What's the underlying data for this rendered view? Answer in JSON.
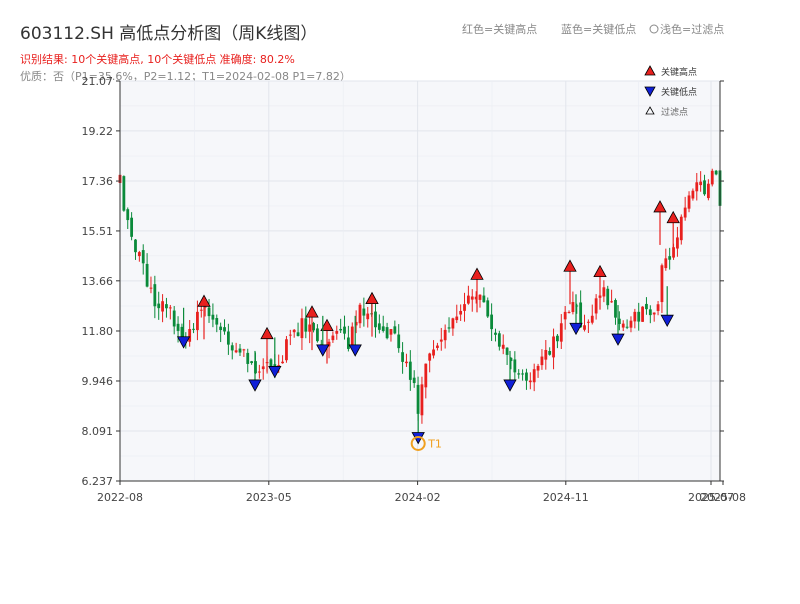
{
  "chart_data": {
    "type": "candlestick",
    "title": "603112.SH 高低点分析图（周K线图）",
    "subtitle_result": "识别结果: 10个关键高点, 10个关键低点   准确度: 80.2%",
    "subtitle_quality": "优质：否（P1=35.6%，P2=1.12；T1=2024-02-08 P1=7.82）",
    "header_legend": [
      "红色=关键高点",
      "蓝色=关键低点",
      "浅色=过滤点"
    ],
    "legend": [
      {
        "name": "关键高点",
        "marker": "triangle-up",
        "color": "#e8201e"
      },
      {
        "name": "关键低点",
        "marker": "triangle-down",
        "color": "#1020d8"
      },
      {
        "name": "过滤点",
        "marker": "triangle-up-hollow",
        "color": "#333333"
      }
    ],
    "y_ticks": [
      "6.237",
      "8.091",
      "9.946",
      "11.80",
      "13.66",
      "15.51",
      "17.36",
      "19.22",
      "21.07"
    ],
    "ylim": [
      6.237,
      21.07
    ],
    "x_ticks": [
      {
        "label": "2022-08",
        "t": 0.0
      },
      {
        "label": "2023-05",
        "t": 0.248
      },
      {
        "label": "2024-02",
        "t": 0.496
      },
      {
        "label": "2024-11",
        "t": 0.743
      },
      {
        "label": "2025-07",
        "t": 0.985
      },
      {
        "label": "2025-08",
        "t": 1.005
      }
    ],
    "grid_minor_t": [
      0.124,
      0.372,
      0.62,
      0.864
    ],
    "close_anchors": [
      [
        0.0,
        17.3
      ],
      [
        0.01,
        15.8
      ],
      [
        0.02,
        15.0
      ],
      [
        0.035,
        14.3
      ],
      [
        0.05,
        13.5
      ],
      [
        0.06,
        12.8
      ],
      [
        0.08,
        12.6
      ],
      [
        0.1,
        12.0
      ],
      [
        0.106,
        11.5
      ],
      [
        0.14,
        12.7
      ],
      [
        0.16,
        12.0
      ],
      [
        0.18,
        11.3
      ],
      [
        0.21,
        11.0
      ],
      [
        0.225,
        10.5
      ],
      [
        0.245,
        10.9
      ],
      [
        0.265,
        10.5
      ],
      [
        0.28,
        11.3
      ],
      [
        0.3,
        11.9
      ],
      [
        0.32,
        12.1
      ],
      [
        0.335,
        11.2
      ],
      [
        0.345,
        11.6
      ],
      [
        0.36,
        11.9
      ],
      [
        0.38,
        11.4
      ],
      [
        0.392,
        11.9
      ],
      [
        0.4,
        12.6
      ],
      [
        0.42,
        12.2
      ],
      [
        0.44,
        12.0
      ],
      [
        0.46,
        11.3
      ],
      [
        0.48,
        10.5
      ],
      [
        0.492,
        9.5
      ],
      [
        0.497,
        8.6
      ],
      [
        0.505,
        10.0
      ],
      [
        0.52,
        11.2
      ],
      [
        0.54,
        12.0
      ],
      [
        0.56,
        12.3
      ],
      [
        0.58,
        12.8
      ],
      [
        0.595,
        13.4
      ],
      [
        0.61,
        12.3
      ],
      [
        0.63,
        11.2
      ],
      [
        0.65,
        10.7
      ],
      [
        0.67,
        10.2
      ],
      [
        0.68,
        10.0
      ],
      [
        0.7,
        10.6
      ],
      [
        0.72,
        11.3
      ],
      [
        0.74,
        12.0
      ],
      [
        0.75,
        12.9
      ],
      [
        0.77,
        12.0
      ],
      [
        0.79,
        12.6
      ],
      [
        0.805,
        13.3
      ],
      [
        0.82,
        12.8
      ],
      [
        0.835,
        12.2
      ],
      [
        0.85,
        12.3
      ],
      [
        0.87,
        12.4
      ],
      [
        0.885,
        12.5
      ],
      [
        0.895,
        12.7
      ],
      [
        0.905,
        14.8
      ],
      [
        0.918,
        14.5
      ],
      [
        0.93,
        15.1
      ],
      [
        0.945,
        16.8
      ],
      [
        0.96,
        17.4
      ],
      [
        0.975,
        16.9
      ],
      [
        0.985,
        17.8
      ],
      [
        0.99,
        18.4
      ],
      [
        1.0,
        16.2
      ]
    ],
    "key_highs": [
      {
        "t": 0.14,
        "v": 12.9
      },
      {
        "t": 0.245,
        "v": 11.7
      },
      {
        "t": 0.32,
        "v": 12.5
      },
      {
        "t": 0.345,
        "v": 12.0
      },
      {
        "t": 0.42,
        "v": 13.0
      },
      {
        "t": 0.595,
        "v": 13.9
      },
      {
        "t": 0.75,
        "v": 14.2
      },
      {
        "t": 0.8,
        "v": 14.0
      },
      {
        "t": 0.9,
        "v": 16.4
      },
      {
        "t": 0.922,
        "v": 16.0
      }
    ],
    "key_lows": [
      {
        "t": 0.106,
        "v": 11.4
      },
      {
        "t": 0.225,
        "v": 9.8
      },
      {
        "t": 0.258,
        "v": 10.3
      },
      {
        "t": 0.338,
        "v": 11.1
      },
      {
        "t": 0.392,
        "v": 11.1
      },
      {
        "t": 0.497,
        "v": 7.85
      },
      {
        "t": 0.65,
        "v": 9.8
      },
      {
        "t": 0.76,
        "v": 11.9
      },
      {
        "t": 0.83,
        "v": 11.5
      },
      {
        "t": 0.912,
        "v": 12.2
      }
    ],
    "t1": {
      "label": "T1",
      "t": 0.497,
      "v": 7.85
    },
    "colors": {
      "up": "#e8201e",
      "down": "#0a8a3a",
      "high": "#e8201e",
      "low": "#1020d8",
      "t1": "#f0a020",
      "plot_bg": "#f6f7fa",
      "grid": "#e2e5ec"
    }
  }
}
